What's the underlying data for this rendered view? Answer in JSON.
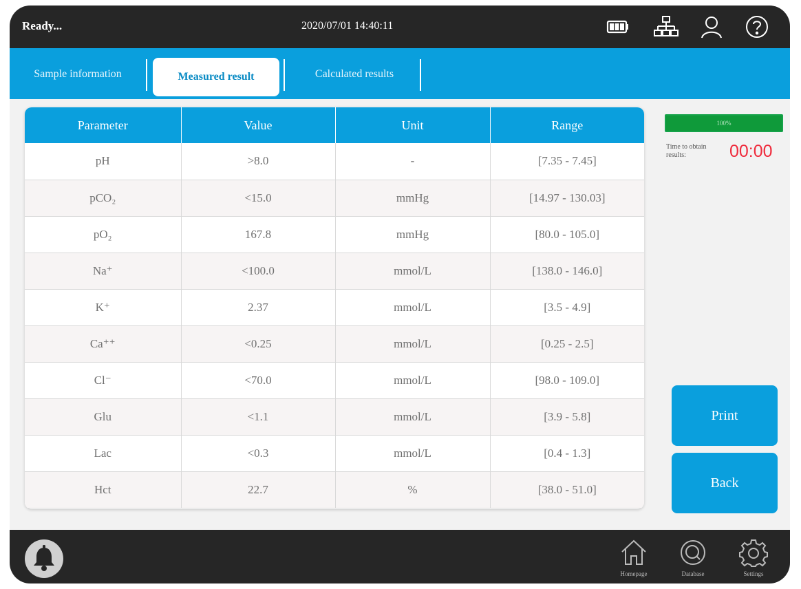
{
  "status": {
    "text": "Ready..."
  },
  "datetime": "2020/07/01  14:40:11",
  "top_icons": [
    "battery-icon",
    "network-icon",
    "user-icon",
    "help-icon"
  ],
  "tabs": [
    {
      "label": "Sample information",
      "active": false
    },
    {
      "label": "Measured result",
      "active": true
    },
    {
      "label": "Calculated results",
      "active": false
    }
  ],
  "table": {
    "columns": [
      "Parameter",
      "Value",
      "Unit",
      "Range"
    ],
    "rows": [
      [
        "pH",
        ">8.0",
        "-",
        "[7.35 - 7.45]"
      ],
      [
        "pCO₂",
        "<15.0",
        "mmHg",
        "[14.97 - 130.03]"
      ],
      [
        "pO₂",
        "167.8",
        "mmHg",
        "[80.0 - 105.0]"
      ],
      [
        "Na⁺",
        "<100.0",
        "mmol/L",
        "[138.0 - 146.0]"
      ],
      [
        "K⁺",
        "2.37",
        "mmol/L",
        "[3.5 - 4.9]"
      ],
      [
        "Ca⁺⁺",
        "<0.25",
        "mmol/L",
        "[0.25 - 2.5]"
      ],
      [
        "Cl⁻",
        "<70.0",
        "mmol/L",
        "[98.0 - 109.0]"
      ],
      [
        "Glu",
        "<1.1",
        "mmol/L",
        "[3.9 - 5.8]"
      ],
      [
        "Lac",
        "<0.3",
        "mmol/L",
        "[0.4 - 1.3]"
      ],
      [
        "Hct",
        "22.7",
        "%",
        "[38.0 - 51.0]"
      ]
    ]
  },
  "progress": {
    "value": 1.0,
    "label": "100%"
  },
  "timer": {
    "label": "Time to obtain results:",
    "value": "00:00"
  },
  "buttons": {
    "print": "Print",
    "back": "Back"
  },
  "nav": [
    {
      "icon": "home-icon",
      "label": "Homepage"
    },
    {
      "icon": "database-icon",
      "label": "Database"
    },
    {
      "icon": "settings-icon",
      "label": "Settings"
    }
  ],
  "colors": {
    "accent": "#0a9fdd",
    "bar": "#262626",
    "progress": "#0f9a3a",
    "timer": "#ef2b3c"
  }
}
